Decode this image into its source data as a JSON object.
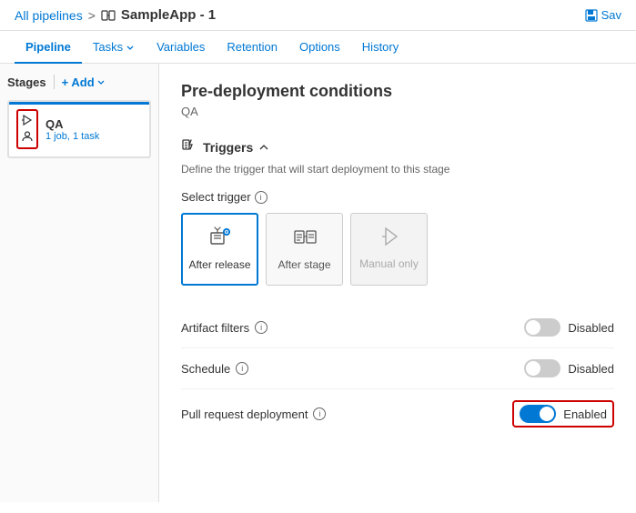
{
  "breadcrumb": {
    "all_pipelines": "All pipelines",
    "separator": ">",
    "app_name": "SampleApp - 1"
  },
  "save_button": "Sav",
  "nav": {
    "tabs": [
      {
        "id": "pipeline",
        "label": "Pipeline",
        "active": true
      },
      {
        "id": "tasks",
        "label": "Tasks",
        "has_arrow": true
      },
      {
        "id": "variables",
        "label": "Variables"
      },
      {
        "id": "retention",
        "label": "Retention"
      },
      {
        "id": "options",
        "label": "Options"
      },
      {
        "id": "history",
        "label": "History"
      }
    ]
  },
  "sidebar": {
    "stages_label": "Stages",
    "add_label": "+ Add",
    "stage": {
      "name": "QA",
      "meta": "1 job, 1 task"
    }
  },
  "content": {
    "title": "Pre-deployment conditions",
    "subtitle": "QA",
    "triggers_section": "Triggers",
    "triggers_desc": "Define the trigger that will start deployment to this stage",
    "select_trigger_label": "Select trigger",
    "trigger_options": [
      {
        "id": "after_release",
        "label": "After release",
        "selected": true,
        "icon": "🏭"
      },
      {
        "id": "after_stage",
        "label": "After stage",
        "selected": false,
        "icon": "☰"
      },
      {
        "id": "manual_only",
        "label": "Manual only",
        "selected": false,
        "icon": "⚡",
        "disabled": true
      }
    ],
    "settings": [
      {
        "id": "artifact_filters",
        "label": "Artifact filters",
        "status": "Disabled",
        "enabled": false,
        "highlighted": false
      },
      {
        "id": "schedule",
        "label": "Schedule",
        "status": "Disabled",
        "enabled": false,
        "highlighted": false
      },
      {
        "id": "pull_request_deployment",
        "label": "Pull request deployment",
        "status": "Enabled",
        "enabled": true,
        "highlighted": true
      }
    ]
  }
}
